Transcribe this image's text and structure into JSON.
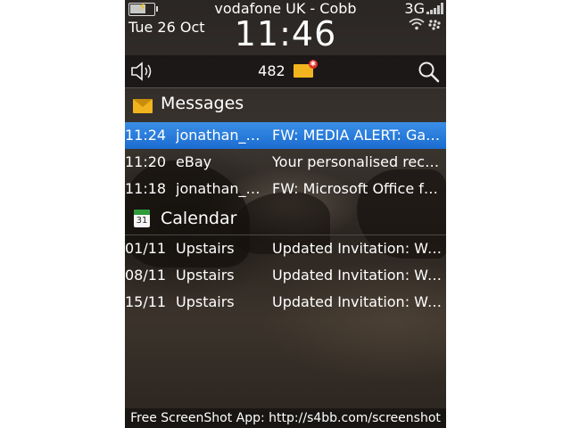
{
  "status": {
    "carrier": "vodafone UK - Cobb",
    "date": "Tue 26 Oct",
    "time": "11:46",
    "network": "3G",
    "battery_level": 0.65
  },
  "toolbar": {
    "message_count": "482",
    "speaker_icon": "speaker-icon",
    "search_icon": "search-icon"
  },
  "messages": {
    "title": "Messages",
    "items": [
      {
        "time": "11:24",
        "sender": "jonathan_b...",
        "subject": "FW: MEDIA ALERT: Gad...",
        "selected": true
      },
      {
        "time": "11:20",
        "sender": "eBay",
        "subject": "Your personalised reco...",
        "selected": false
      },
      {
        "time": "11:18",
        "sender": "jonathan_b...",
        "subject": "FW: Microsoft Office for...",
        "selected": false
      }
    ]
  },
  "calendar": {
    "title": "Calendar",
    "icon_day": "31",
    "items": [
      {
        "date": "01/11",
        "location": "Upstairs",
        "subject": "Updated Invitation: We..."
      },
      {
        "date": "08/11",
        "location": "Upstairs",
        "subject": "Updated Invitation: We..."
      },
      {
        "date": "15/11",
        "location": "Upstairs",
        "subject": "Updated Invitation: We..."
      }
    ]
  },
  "footer": "Free ScreenShot App: http://s4bb.com/screenshot",
  "colors": {
    "selection": "#2a7ddc",
    "envelope": "#f2b41e",
    "background": "#2e2925"
  }
}
